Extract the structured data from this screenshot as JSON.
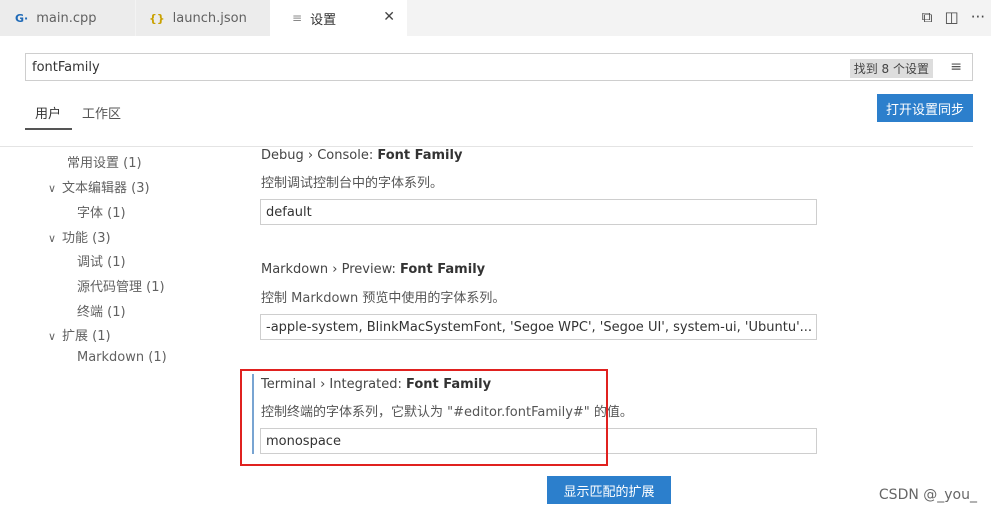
{
  "tabs": [
    {
      "icon": "G·",
      "label": "main.cpp"
    },
    {
      "icon": "{}",
      "label": "launch.json"
    },
    {
      "icon": "≡",
      "label": "设置"
    }
  ],
  "toolbar": {
    "icons": [
      "split-preview-icon",
      "split-editor-icon",
      "more-actions-icon"
    ]
  },
  "search": {
    "value": "fontFamily",
    "count_label": "找到 8 个设置"
  },
  "scopes": {
    "user": "用户",
    "workspace": "工作区"
  },
  "sync_button": "打开设置同步",
  "toc": [
    {
      "label": "常用设置 (1)"
    },
    {
      "label": "文本编辑器 (3)"
    },
    {
      "label": "字体 (1)"
    },
    {
      "label": "功能 (3)"
    },
    {
      "label": "调试 (1)"
    },
    {
      "label": "源代码管理 (1)"
    },
    {
      "label": "终端 (1)"
    },
    {
      "label": "扩展 (1)"
    },
    {
      "label": "Markdown (1)"
    }
  ],
  "settings": [
    {
      "category": "Debug › Console: ",
      "name": "Font Family",
      "description": "控制调试控制台中的字体系列。",
      "value": "default"
    },
    {
      "category": "Markdown › Preview: ",
      "name": "Font Family",
      "description": "控制 Markdown 预览中使用的字体系列。",
      "value": "-apple-system, BlinkMacSystemFont, 'Segoe WPC', 'Segoe UI', system-ui, 'Ubuntu'..."
    },
    {
      "category": "Terminal › Integrated: ",
      "name": "Font Family",
      "description": "控制终端的字体系列，它默认为 \"#editor.fontFamily#\" 的值。",
      "value": "monospace"
    }
  ],
  "extensions_button": "显示匹配的扩展",
  "watermark": "CSDN @_you_",
  "colors": {
    "accent_button": "#2c7fcc",
    "highlight_box": "#e0211f"
  }
}
